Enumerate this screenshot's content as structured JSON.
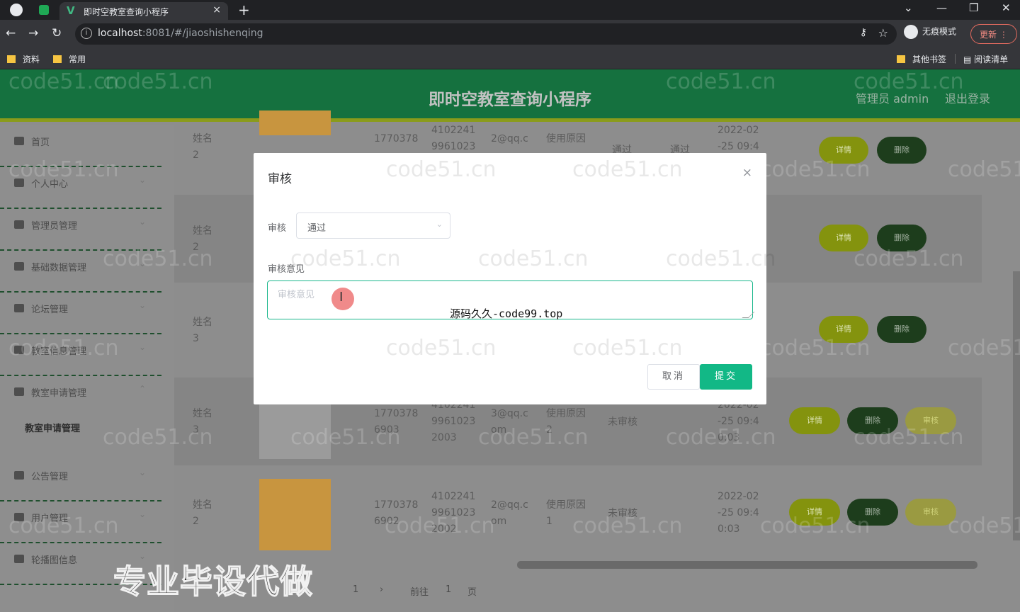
{
  "browser": {
    "tab_title": "即时空教室查询小程序",
    "tab_close": "×",
    "new_tab": "+",
    "url_host": "localhost",
    "url_rest": ":8081/#/jiaoshishenqing",
    "incognito_label": "无痕模式",
    "update_label": "更新",
    "bookmarks": [
      "资料",
      "常用"
    ],
    "other_bookmarks": "其他书签",
    "reading_list": "阅读清单"
  },
  "header": {
    "title": "即时空教室查询小程序",
    "admin_label": "管理员 admin",
    "logout_label": "退出登录"
  },
  "sidebar": {
    "items": [
      {
        "label": "首页"
      },
      {
        "label": "个人中心"
      },
      {
        "label": "管理员管理"
      },
      {
        "label": "基础数据管理"
      },
      {
        "label": "论坛管理"
      },
      {
        "label": "教室信息管理"
      },
      {
        "label": "教室申请管理"
      },
      {
        "label": "公告管理"
      },
      {
        "label": "用户管理"
      },
      {
        "label": "轮播图信息"
      }
    ],
    "active_sub": "教室申请管理"
  },
  "table": {
    "rows": [
      {
        "name": "姓名\n2",
        "phone": "1770378",
        "idcard": "4102241\n9961023",
        "email": "2@qq.c",
        "reason": "使用原因",
        "status": "通过",
        "review": "通过",
        "time": "2022-02\n-25 09:4",
        "buttons": [
          "详情",
          "删除"
        ]
      },
      {
        "name": "姓名\n2",
        "phone": "",
        "idcard": "",
        "email": "",
        "reason": "",
        "status": "",
        "review": "",
        "time": "",
        "buttons": [
          "详情",
          "删除"
        ]
      },
      {
        "name": "姓名\n3",
        "phone": "",
        "idcard": "",
        "email": "",
        "reason": "",
        "status": "",
        "review": "",
        "time": "",
        "buttons": [
          "详情",
          "删除"
        ]
      },
      {
        "name": "姓名\n3",
        "phone": "1770378\n6903",
        "idcard": "4102241\n9961023\n2003",
        "email": "3@qq.c\nom",
        "reason": "使用原因\n2",
        "status": "未审核",
        "review": "",
        "time": "2022-02\n-25 09:4\n0:03",
        "buttons": [
          "详情",
          "删除",
          "审核"
        ]
      },
      {
        "name": "姓名\n2",
        "phone": "1770378\n6902",
        "idcard": "4102241\n9961023\n2002",
        "email": "2@qq.c\nom",
        "reason": "使用原因\n1",
        "status": "未审核",
        "review": "",
        "time": "2022-02\n-25 09:4\n0:03",
        "buttons": [
          "详情",
          "删除",
          "审核"
        ]
      }
    ]
  },
  "pager": {
    "current": "1",
    "goto_label": "前往",
    "goto_value": "1",
    "page_suffix": "页"
  },
  "promo_text": "专业毕设代做",
  "watermark_text": "code51.cn",
  "dialog": {
    "title": "审核",
    "close": "×",
    "audit_label": "审核",
    "audit_value": "通过",
    "opinion_label": "审核意见",
    "opinion_placeholder": "审核意见",
    "site_watermark": "源码久久-code99.top",
    "cancel_label": "取消",
    "submit_label": "提交"
  },
  "colors": {
    "header_green": "#15713f",
    "accent_green": "#12b886",
    "detail_button": "#84930e",
    "delete_button": "#1d3d1c",
    "audit_button": "#9a9a41"
  }
}
